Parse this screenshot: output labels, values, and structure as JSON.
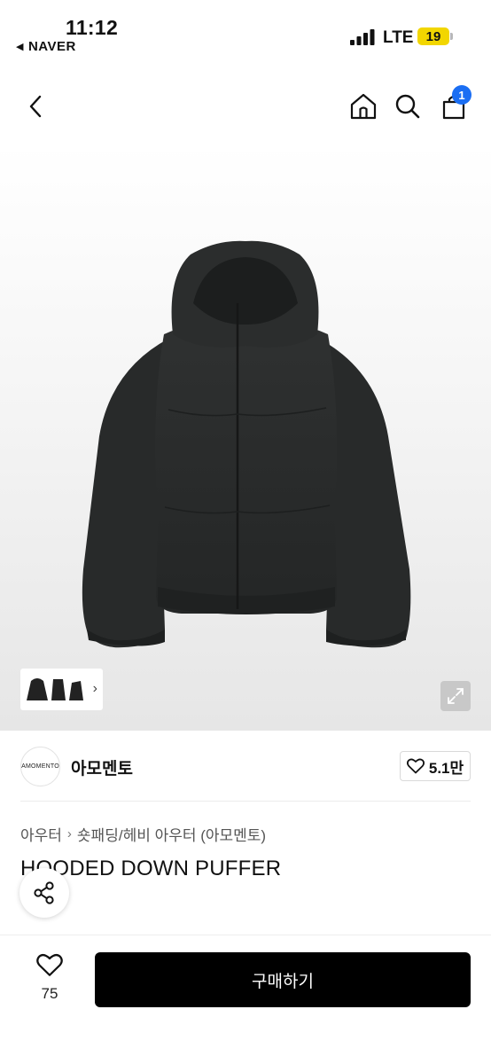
{
  "status": {
    "time": "11:12",
    "back_app": "NAVER",
    "network": "LTE",
    "battery": "19"
  },
  "nav": {
    "cart_count": "1"
  },
  "gallery": {
    "thumb_arrow": "›"
  },
  "brand": {
    "logo_text": "AMOMENTO",
    "name": "아모멘토",
    "likes": "5.1만"
  },
  "product": {
    "breadcrumb": [
      "아우터",
      "숏패딩/헤비 아우터 (아모멘토)"
    ],
    "title": "HOODED DOWN PUFFER"
  },
  "bottom": {
    "wish_count": "75",
    "buy_label": "구매하기"
  },
  "colors": {
    "accent": "#1b6ef3",
    "battery": "#f2d600",
    "buy_button": "#000000"
  },
  "icons": [
    "back-arrow-icon",
    "home-icon",
    "search-icon",
    "cart-icon",
    "expand-icon",
    "heart-icon",
    "share-icon"
  ]
}
